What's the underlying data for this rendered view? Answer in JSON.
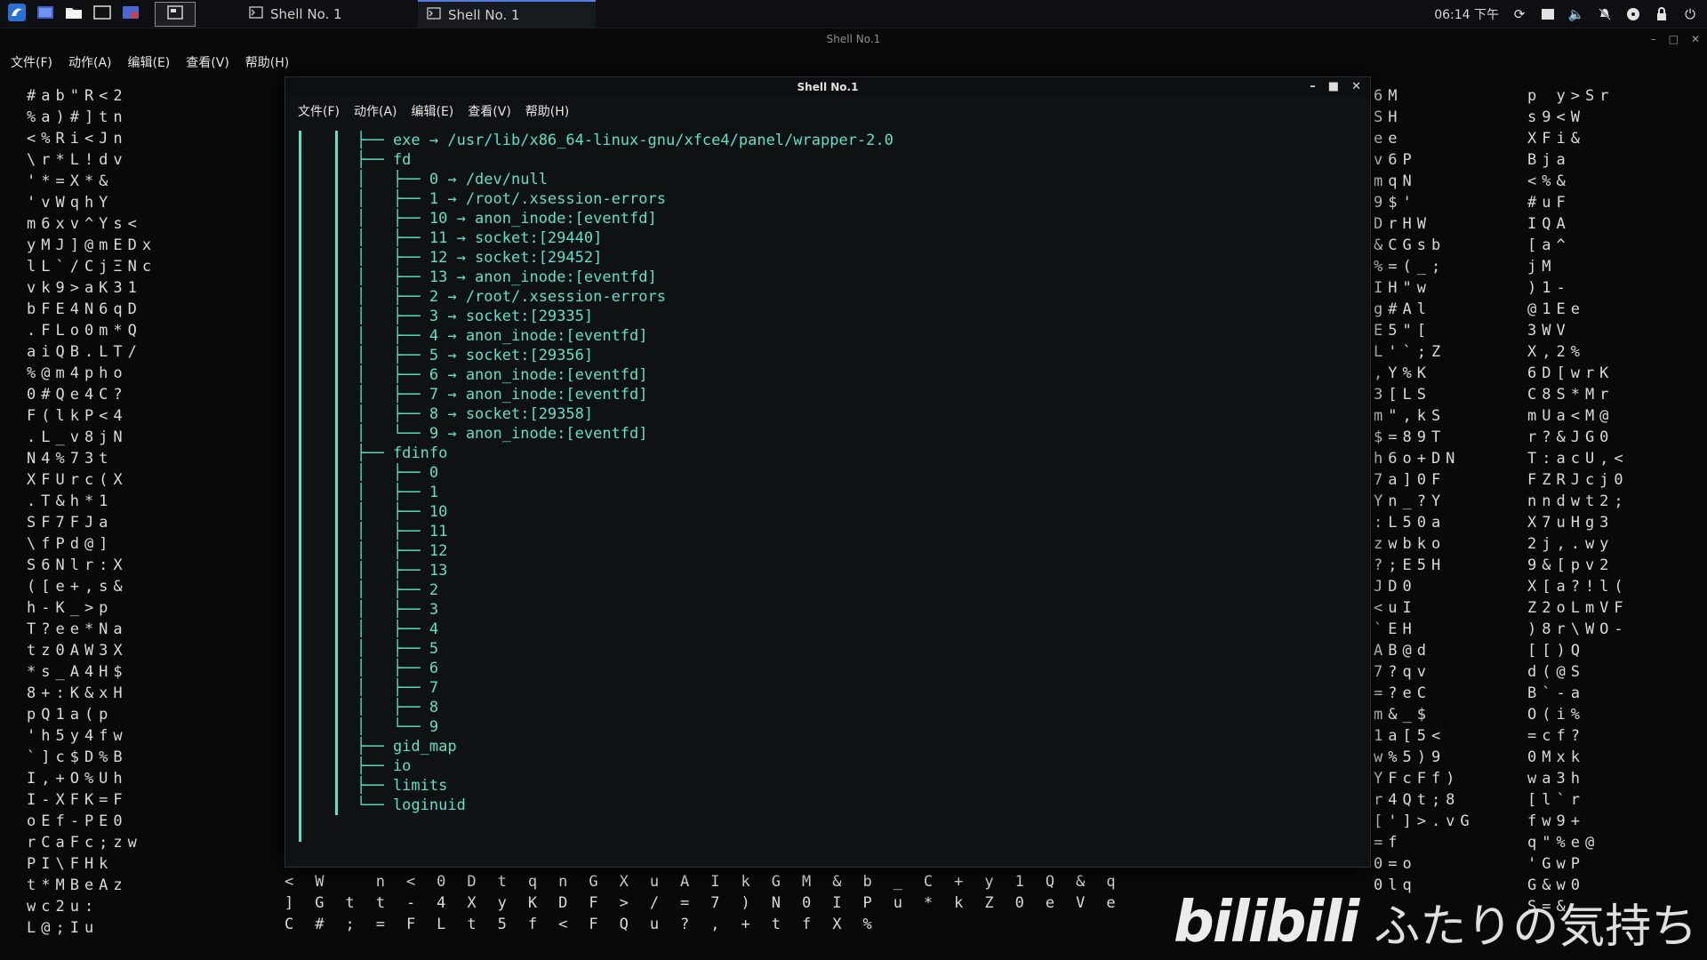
{
  "taskbar": {
    "windows": [
      {
        "label": "Shell No. 1",
        "active": false
      },
      {
        "label": "Shell No. 1",
        "active": true
      }
    ],
    "clock": "06:14 下午"
  },
  "bg_window": {
    "title": "Shell No.1",
    "menu": [
      "文件(F)",
      "动作(A)",
      "编辑(E)",
      "查看(V)",
      "帮助(H)"
    ]
  },
  "shell_window": {
    "title": "Shell No.1",
    "menu": [
      "文件(F)",
      "动作(A)",
      "编辑(E)",
      "查看(V)",
      "帮助(H)"
    ]
  },
  "terminal_lines": [
    "├── exe → /usr/lib/x86_64-linux-gnu/xfce4/panel/wrapper-2.0",
    "├── fd",
    "│   ├── 0 → /dev/null",
    "│   ├── 1 → /root/.xsession-errors",
    "│   ├── 10 → anon_inode:[eventfd]",
    "│   ├── 11 → socket:[29440]",
    "│   ├── 12 → socket:[29452]",
    "│   ├── 13 → anon_inode:[eventfd]",
    "│   ├── 2 → /root/.xsession-errors",
    "│   ├── 3 → socket:[29335]",
    "│   ├── 4 → anon_inode:[eventfd]",
    "│   ├── 5 → socket:[29356]",
    "│   ├── 6 → anon_inode:[eventfd]",
    "│   ├── 7 → anon_inode:[eventfd]",
    "│   ├── 8 → socket:[29358]",
    "│   └── 9 → anon_inode:[eventfd]",
    "├── fdinfo",
    "│   ├── 0",
    "│   ├── 1",
    "│   ├── 10",
    "│   ├── 11",
    "│   ├── 12",
    "│   ├── 13",
    "│   ├── 2",
    "│   ├── 3",
    "│   ├── 4",
    "│   ├── 5",
    "│   ├── 6",
    "│   ├── 7",
    "│   ├── 8",
    "│   └── 9",
    "├── gid_map",
    "├── io",
    "├── limits",
    "└── loginuid"
  ],
  "matrix_left": [
    "#ab\"R<2\n%a)#]tn\n<%Ri<Jn\n\\r*L!dv\n'*=X*&\n'vWqhY\nm6xv^Ys<\nyMJ]@mEDx\nlL`/CjΞNc\nvk9>aK31\nbFE4N6qD\n.FLo0m*Q\naiQB.LT/\n%@m4pho\n0#Qe4C?\nF(lkP<4\n.L_v8jN\nN4%73t\nXFUrc(X\n.T&h*1\nSF7FJa\n\\fPd@]\nS6Nlr:X\n([e+,s&\nh-K_>p\nT?ee*Na\ntz0AW3X\n*s_A4H$\n8+:K&xH\npQ1a(p\n'h5y4fw\n`]c$D%B\nI,+O%Uh\nI-XFK=F\noEf-PE0\nrCaFc;zw\nPI\\FHk\nt*MBeAz\nwc2u:\nL@;Iu"
  ],
  "matrix_right_1": "6M\nSH\nee\nv6P\nmqN\n9$'\nDrHW\n&CGsb\n%=(_;\nIH\"w\ng#Al\nE5\"[\nL'`;Z\n,Y%K\n3[LS\nm\",kS\n$=89T\nh6o+DN\n7a]0F\nYn_?Y\n:L50a\nzwbko\n?;E5H\nJD0\n<uI\n`EH\nAB@d\n7?qv\n=?eC\nm&_$\n1a[5<\nw%5)9\nYFcFf)\nr4Qt;8\n[']>.vG\n=f\n0=o\n0lq",
  "matrix_right_2": "p y>Sr\ns9<W\nXFi&\nBja\n<%&\n#uF\nIQA\n[a^\njM\n)1-\n@1Ee\n3WV\nX,2%\n6D[wrK\nC8S*Mr\nmUa<M@\nr?&JG0\nT:acU,<\nFZRJcj0\nnndwt2;\nX7uHg3\n2j,.wy\n9&[pv2\nX[a?!l(\nZ2oLmVF\n)8r\\WO-\n[[)Q\nd(@S\nB`-a\nO(i%\n=cf?\n0Mxk\nwa3h\n[l`r\nfw9+\nq\"%e@\n'GwP\nG&w0\nS=&",
  "matrix_bottom": "<W n<0DtqnGXuAIkGM&b_C+y1Q&q\n]Gtt-4XyKDF>/=7)N0IPu*kZ0eVe\nC#;=FLt5f<FQu?,+tfX%"
}
